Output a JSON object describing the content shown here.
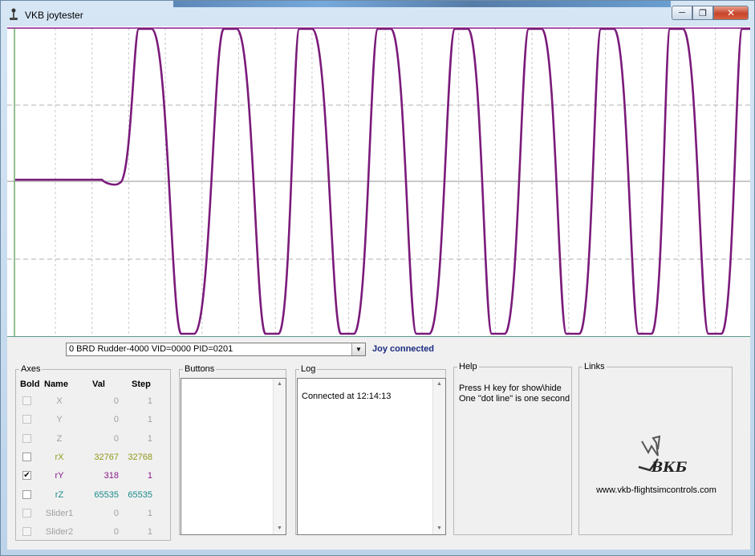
{
  "window": {
    "title": "VKB joytester",
    "app_icon": "joystick-icon"
  },
  "graph": {
    "description_note": null,
    "trace_color": "#7a1a7a",
    "grid_color": "#b0b0b0"
  },
  "device": {
    "selected": "0 BRD Rudder-4000 VID=0000 PID=0201",
    "status": "Joy connected"
  },
  "axes": {
    "legend": "Axes",
    "headers": {
      "bold": "Bold",
      "name": "Name",
      "val": "Val",
      "step": "Step"
    },
    "rows": [
      {
        "name": "X",
        "val": "0",
        "step": "1",
        "checked": false,
        "enabled": false,
        "color": "#a0a0a0"
      },
      {
        "name": "Y",
        "val": "0",
        "step": "1",
        "checked": false,
        "enabled": false,
        "color": "#a0a0a0"
      },
      {
        "name": "Z",
        "val": "0",
        "step": "1",
        "checked": false,
        "enabled": false,
        "color": "#a0a0a0"
      },
      {
        "name": "rX",
        "val": "32767",
        "step": "32768",
        "checked": false,
        "enabled": true,
        "color": "#8f9a1a"
      },
      {
        "name": "rY",
        "val": "318",
        "step": "1",
        "checked": true,
        "enabled": true,
        "color": "#8a1a8a"
      },
      {
        "name": "rZ",
        "val": "65535",
        "step": "65535",
        "checked": false,
        "enabled": true,
        "color": "#1a8a8a"
      },
      {
        "name": "Slider1",
        "val": "0",
        "step": "1",
        "checked": false,
        "enabled": false,
        "color": "#a0a0a0"
      },
      {
        "name": "Slider2",
        "val": "0",
        "step": "1",
        "checked": false,
        "enabled": false,
        "color": "#a0a0a0"
      }
    ]
  },
  "buttons": {
    "legend": "Buttons"
  },
  "log": {
    "legend": "Log",
    "lines": [
      "Connected at 12:14:13"
    ]
  },
  "help": {
    "legend": "Help",
    "line1": "Press H key for show\\hide",
    "line2": "One \"dot line\" is one second"
  },
  "links": {
    "legend": "Links",
    "url": "www.vkb-flightsimcontrols.com",
    "logo_text": "ВКБ"
  }
}
